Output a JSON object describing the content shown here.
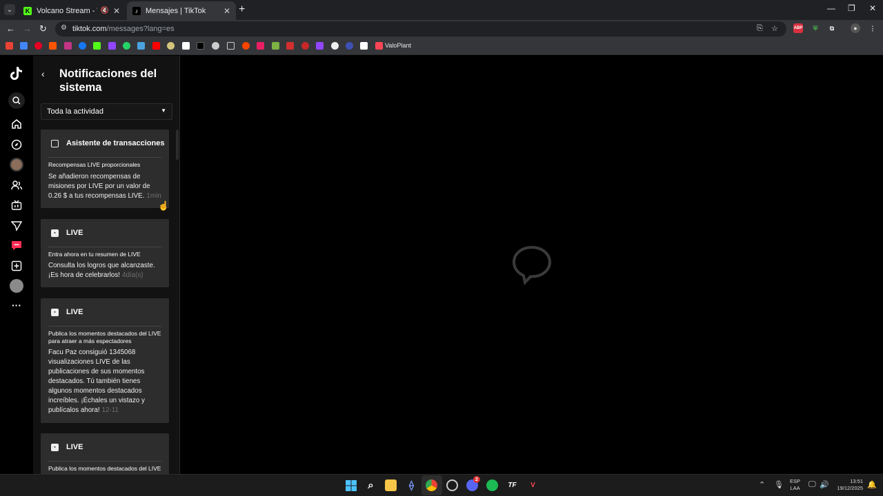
{
  "browser": {
    "tabs": [
      {
        "title": "Volcano Stream - Watch Li",
        "favicon_color": "#53fc18",
        "favicon_glyph": "K",
        "muted_icon": "speaker-muted-icon"
      },
      {
        "title": "Mensajes | TikTok",
        "favicon_color": "#000000",
        "favicon_glyph": "♪"
      }
    ],
    "url_host": "tiktok.com",
    "url_path": "/messages?lang=es",
    "bookmark_label": "ValoPlant"
  },
  "sidebar": {
    "icons": [
      "tiktok-logo-icon",
      "search-icon",
      "home-icon",
      "explore-icon",
      "avatar-icon",
      "following-icon",
      "live-icon",
      "send-icon",
      "messages-icon",
      "upload-icon",
      "profile-icon",
      "more-icon"
    ]
  },
  "panel": {
    "title": "Notificaciones del sistema",
    "filter_label": "Toda la actividad",
    "cards": [
      {
        "title": "Asistente de transacciones",
        "subtitle": "Recompensas LIVE proporcionales",
        "body": "Se añadieron recompensas de misiones por LIVE por un valor de 0.26 $ a tus recompensas LIVE.",
        "time": "1min"
      },
      {
        "title": "LIVE",
        "subtitle": "Entra ahora en tu resumen de LIVE",
        "body": "Consulta los logros que alcanzaste. ¡Es hora de celebrarlos!",
        "time": "4día(s)"
      },
      {
        "title": "LIVE",
        "subtitle": "Publica los momentos destacados del LIVE para atraer a más espectadores",
        "body": "Facu Paz consiguió 1345068 visualizaciones LIVE de las publicaciones de sus momentos destacados. Tú también tienes algunos momentos destacados increíbles. ¡Échales un vistazo y publícalos ahora!",
        "time": "12-11"
      },
      {
        "title": "LIVE",
        "subtitle": "Publica los momentos destacados del LIVE"
      }
    ]
  },
  "taskbar": {
    "lang_top": "ESP",
    "lang_bottom": "LAA",
    "time": "13:51",
    "date": "19/12/2025",
    "discord_badge": "2"
  }
}
